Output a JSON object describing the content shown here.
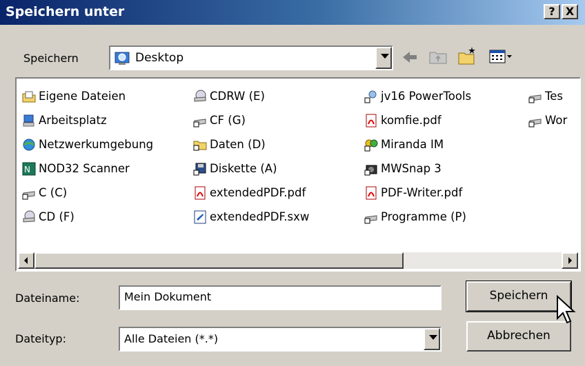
{
  "window": {
    "title": "Speichern unter",
    "help_label": "?",
    "close_label": "X"
  },
  "save_in": {
    "label": "Speichern",
    "value": "Desktop"
  },
  "toolbar": {
    "icons": [
      "back-arrow-icon",
      "up-folder-icon",
      "new-folder-icon",
      "view-menu-icon"
    ]
  },
  "files": {
    "columns": [
      [
        {
          "label": "Eigene Dateien",
          "icon": "folder-documents-icon"
        },
        {
          "label": "Arbeitsplatz",
          "icon": "computer-icon"
        },
        {
          "label": "Netzwerkumgebung",
          "icon": "network-icon"
        },
        {
          "label": "NOD32 Scanner",
          "icon": "shortcut-app-icon"
        },
        {
          "label": "C (C)",
          "icon": "drive-icon"
        },
        {
          "label": "CD (F)",
          "icon": "cd-drive-icon"
        }
      ],
      [
        {
          "label": "CDRW (E)",
          "icon": "cd-drive-icon"
        },
        {
          "label": "CF (G)",
          "icon": "drive-icon"
        },
        {
          "label": "Daten (D)",
          "icon": "folder-shortcut-icon"
        },
        {
          "label": "Diskette (A)",
          "icon": "floppy-icon"
        },
        {
          "label": "extendedPDF.pdf",
          "icon": "pdf-icon"
        },
        {
          "label": "extendedPDF.sxw",
          "icon": "writer-doc-icon"
        }
      ],
      [
        {
          "label": "jv16 PowerTools",
          "icon": "shortcut-app-icon"
        },
        {
          "label": "komfie.pdf",
          "icon": "pdf-icon"
        },
        {
          "label": "Miranda IM",
          "icon": "miranda-icon"
        },
        {
          "label": "MWSnap 3",
          "icon": "mwsnap-icon"
        },
        {
          "label": "PDF-Writer.pdf",
          "icon": "pdf-icon"
        },
        {
          "label": "Programme (P)",
          "icon": "drive-icon"
        }
      ],
      [
        {
          "label": "Tes",
          "icon": "drive-icon"
        },
        {
          "label": "Wor",
          "icon": "drive-icon"
        }
      ]
    ]
  },
  "filename": {
    "label": "Dateiname:",
    "value": "Mein Dokument"
  },
  "filetype": {
    "label": "Dateityp:",
    "value": "Alle Dateien (*.*)"
  },
  "buttons": {
    "save": "Speichern",
    "cancel": "Abbrechen"
  }
}
